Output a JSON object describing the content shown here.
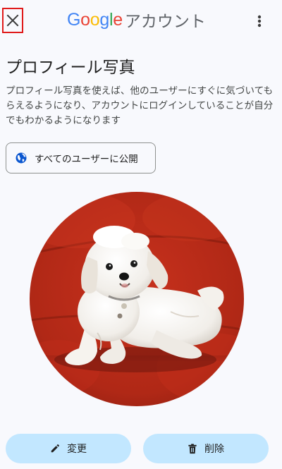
{
  "header": {
    "logo_letters": [
      "G",
      "o",
      "o",
      "g",
      "l",
      "e"
    ],
    "logo_colors": [
      "#4285f4",
      "#ea4335",
      "#fbbc05",
      "#4285f4",
      "#34a853",
      "#ea4335"
    ],
    "account_label": "アカウント",
    "close_icon": "close-icon",
    "menu_icon": "more-vert-icon",
    "close_outline_color": "#e01b1b"
  },
  "page": {
    "title": "プロフィール写真",
    "description": "プロフィール写真を使えば、他のユーザーにすぐに気づいてもらえるようになり、アカウントにログインしていることが自分でもわかるようになります"
  },
  "visibility": {
    "label": "すべてのユーザーに公開",
    "icon": "globe-icon"
  },
  "photo": {
    "subject": "white puppy lying on a red sofa"
  },
  "actions": {
    "change_label": "変更",
    "change_icon": "pencil-icon",
    "delete_label": "削除",
    "delete_icon": "trash-icon",
    "button_color": "#c2e7ff"
  },
  "colors": {
    "background": "#f8f9fd",
    "accent": "#0b57d0"
  }
}
